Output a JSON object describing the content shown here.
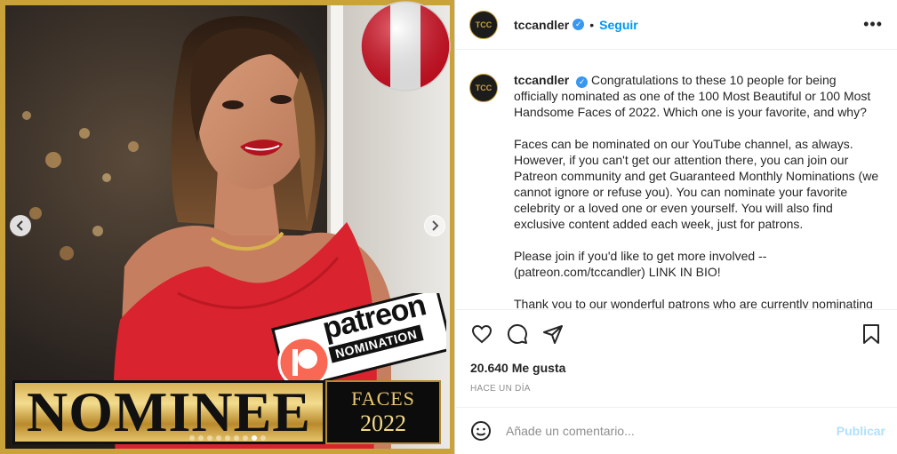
{
  "media": {
    "badge_patreon": "patreon",
    "badge_nomination": "NOMINATION",
    "banner_nominee": "NOMINEE",
    "banner_faces": "FACES",
    "banner_year": "2022",
    "prev_icon": "chevron-left-icon",
    "next_icon": "chevron-right-icon",
    "slide_count": 9,
    "active_slide": 8,
    "colors": {
      "frame_gold": "#c9a23a",
      "dress_red": "#d9232e",
      "patreon_red": "#f96854",
      "peru_red": "#d91023"
    }
  },
  "header": {
    "username": "tccandler",
    "separator": "•",
    "follow_label": "Seguir",
    "more_icon": "•••",
    "verified_icon": "✓"
  },
  "caption": {
    "username": "tccandler",
    "paragraphs": [
      "Congratulations to these 10 people for being officially nominated as one of the 100 Most Beautiful or 100 Most Handsome Faces of 2022.  Which one is your favorite, and why?",
      "Faces can be nominated on our YouTube channel, as always.  However, if you can't get our attention there, you can join our Patreon community and get Guaranteed Monthly Nominations (we cannot ignore or refuse you).  You can nominate your favorite celebrity or a loved one or even yourself.  You will also find exclusive content added each week, just for patrons.",
      "Please join if you'd like to get more involved -- (patreon.com/tccandler) LINK IN BIO!",
      "Thank you to our wonderful patrons who are currently nominating"
    ]
  },
  "actions": {
    "likes": "20.640 Me gusta",
    "time_ago": "HACE UN DÍA",
    "icons": [
      "heart-icon",
      "comment-icon",
      "share-icon",
      "bookmark-icon"
    ]
  },
  "comment": {
    "placeholder": "Añade un comentario...",
    "publish_label": "Publicar",
    "emoji_icon": "emoji-icon"
  }
}
